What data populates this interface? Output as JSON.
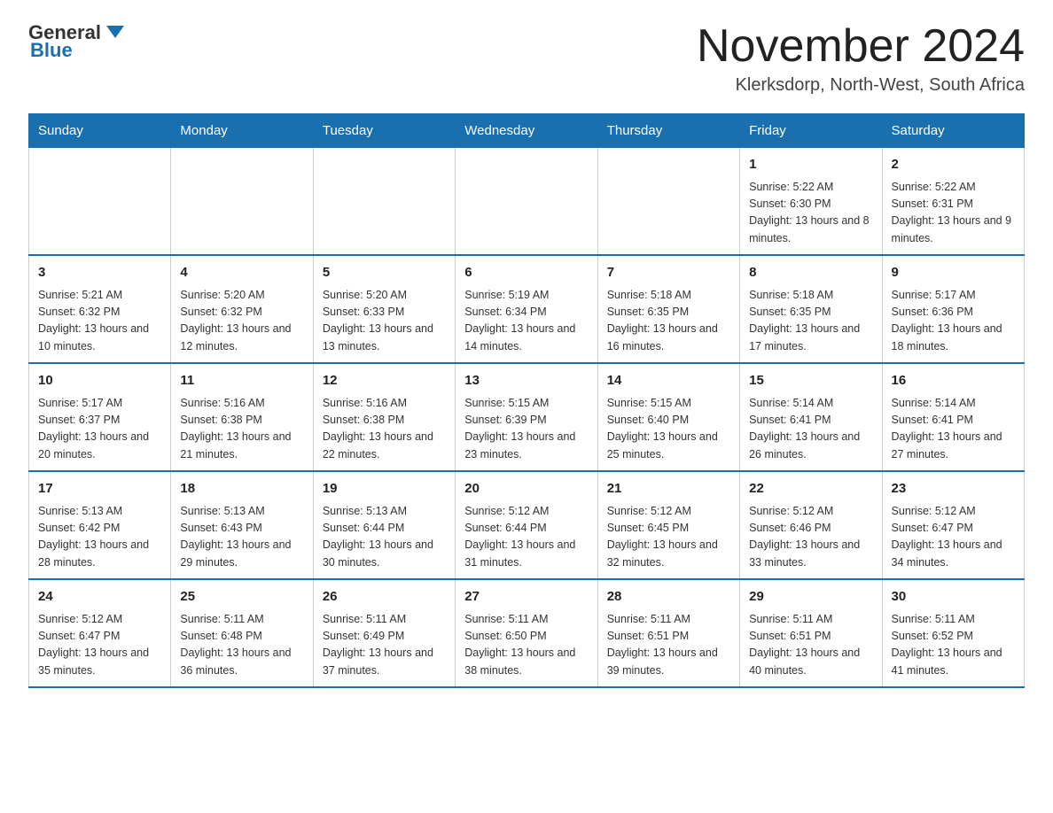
{
  "header": {
    "logo_general": "General",
    "logo_blue": "Blue",
    "month_title": "November 2024",
    "location": "Klerksdorp, North-West, South Africa"
  },
  "weekdays": [
    "Sunday",
    "Monday",
    "Tuesday",
    "Wednesday",
    "Thursday",
    "Friday",
    "Saturday"
  ],
  "weeks": [
    [
      {
        "day": "",
        "info": ""
      },
      {
        "day": "",
        "info": ""
      },
      {
        "day": "",
        "info": ""
      },
      {
        "day": "",
        "info": ""
      },
      {
        "day": "",
        "info": ""
      },
      {
        "day": "1",
        "info": "Sunrise: 5:22 AM\nSunset: 6:30 PM\nDaylight: 13 hours and 8 minutes."
      },
      {
        "day": "2",
        "info": "Sunrise: 5:22 AM\nSunset: 6:31 PM\nDaylight: 13 hours and 9 minutes."
      }
    ],
    [
      {
        "day": "3",
        "info": "Sunrise: 5:21 AM\nSunset: 6:32 PM\nDaylight: 13 hours and 10 minutes."
      },
      {
        "day": "4",
        "info": "Sunrise: 5:20 AM\nSunset: 6:32 PM\nDaylight: 13 hours and 12 minutes."
      },
      {
        "day": "5",
        "info": "Sunrise: 5:20 AM\nSunset: 6:33 PM\nDaylight: 13 hours and 13 minutes."
      },
      {
        "day": "6",
        "info": "Sunrise: 5:19 AM\nSunset: 6:34 PM\nDaylight: 13 hours and 14 minutes."
      },
      {
        "day": "7",
        "info": "Sunrise: 5:18 AM\nSunset: 6:35 PM\nDaylight: 13 hours and 16 minutes."
      },
      {
        "day": "8",
        "info": "Sunrise: 5:18 AM\nSunset: 6:35 PM\nDaylight: 13 hours and 17 minutes."
      },
      {
        "day": "9",
        "info": "Sunrise: 5:17 AM\nSunset: 6:36 PM\nDaylight: 13 hours and 18 minutes."
      }
    ],
    [
      {
        "day": "10",
        "info": "Sunrise: 5:17 AM\nSunset: 6:37 PM\nDaylight: 13 hours and 20 minutes."
      },
      {
        "day": "11",
        "info": "Sunrise: 5:16 AM\nSunset: 6:38 PM\nDaylight: 13 hours and 21 minutes."
      },
      {
        "day": "12",
        "info": "Sunrise: 5:16 AM\nSunset: 6:38 PM\nDaylight: 13 hours and 22 minutes."
      },
      {
        "day": "13",
        "info": "Sunrise: 5:15 AM\nSunset: 6:39 PM\nDaylight: 13 hours and 23 minutes."
      },
      {
        "day": "14",
        "info": "Sunrise: 5:15 AM\nSunset: 6:40 PM\nDaylight: 13 hours and 25 minutes."
      },
      {
        "day": "15",
        "info": "Sunrise: 5:14 AM\nSunset: 6:41 PM\nDaylight: 13 hours and 26 minutes."
      },
      {
        "day": "16",
        "info": "Sunrise: 5:14 AM\nSunset: 6:41 PM\nDaylight: 13 hours and 27 minutes."
      }
    ],
    [
      {
        "day": "17",
        "info": "Sunrise: 5:13 AM\nSunset: 6:42 PM\nDaylight: 13 hours and 28 minutes."
      },
      {
        "day": "18",
        "info": "Sunrise: 5:13 AM\nSunset: 6:43 PM\nDaylight: 13 hours and 29 minutes."
      },
      {
        "day": "19",
        "info": "Sunrise: 5:13 AM\nSunset: 6:44 PM\nDaylight: 13 hours and 30 minutes."
      },
      {
        "day": "20",
        "info": "Sunrise: 5:12 AM\nSunset: 6:44 PM\nDaylight: 13 hours and 31 minutes."
      },
      {
        "day": "21",
        "info": "Sunrise: 5:12 AM\nSunset: 6:45 PM\nDaylight: 13 hours and 32 minutes."
      },
      {
        "day": "22",
        "info": "Sunrise: 5:12 AM\nSunset: 6:46 PM\nDaylight: 13 hours and 33 minutes."
      },
      {
        "day": "23",
        "info": "Sunrise: 5:12 AM\nSunset: 6:47 PM\nDaylight: 13 hours and 34 minutes."
      }
    ],
    [
      {
        "day": "24",
        "info": "Sunrise: 5:12 AM\nSunset: 6:47 PM\nDaylight: 13 hours and 35 minutes."
      },
      {
        "day": "25",
        "info": "Sunrise: 5:11 AM\nSunset: 6:48 PM\nDaylight: 13 hours and 36 minutes."
      },
      {
        "day": "26",
        "info": "Sunrise: 5:11 AM\nSunset: 6:49 PM\nDaylight: 13 hours and 37 minutes."
      },
      {
        "day": "27",
        "info": "Sunrise: 5:11 AM\nSunset: 6:50 PM\nDaylight: 13 hours and 38 minutes."
      },
      {
        "day": "28",
        "info": "Sunrise: 5:11 AM\nSunset: 6:51 PM\nDaylight: 13 hours and 39 minutes."
      },
      {
        "day": "29",
        "info": "Sunrise: 5:11 AM\nSunset: 6:51 PM\nDaylight: 13 hours and 40 minutes."
      },
      {
        "day": "30",
        "info": "Sunrise: 5:11 AM\nSunset: 6:52 PM\nDaylight: 13 hours and 41 minutes."
      }
    ]
  ]
}
